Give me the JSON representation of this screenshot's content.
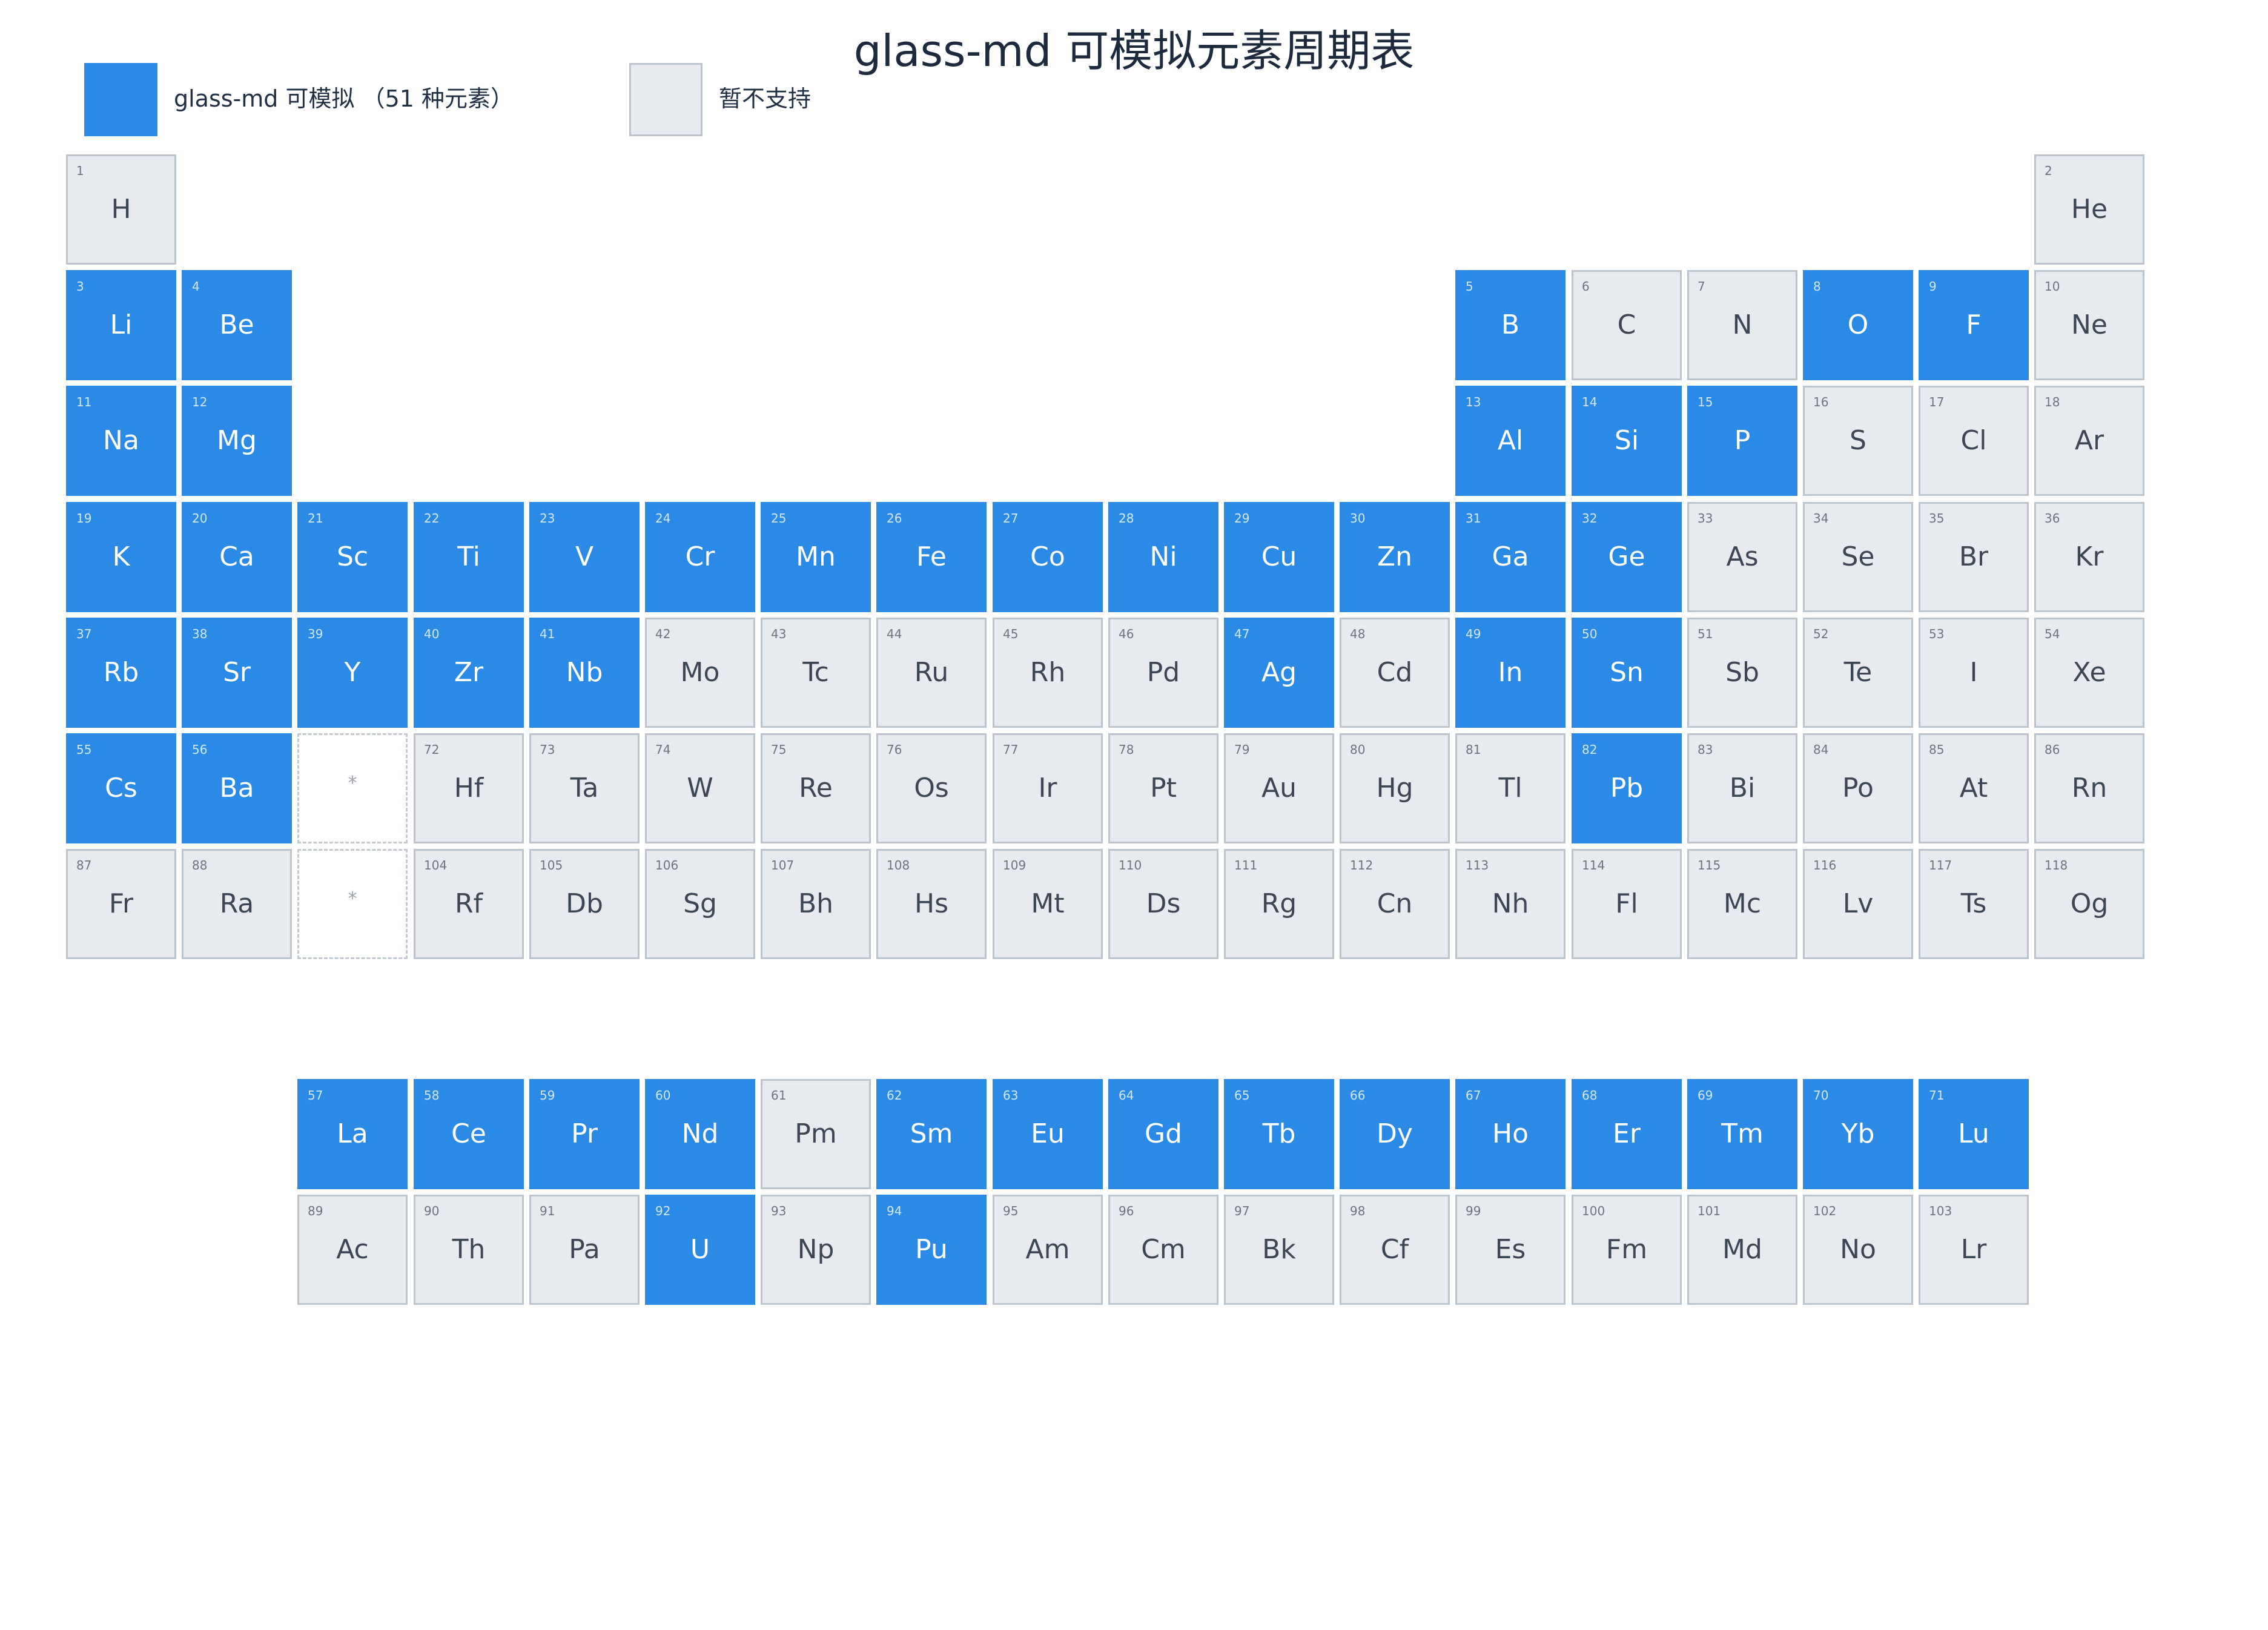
{
  "title": "glass-md 可模拟元素周期表",
  "legend": {
    "supported_label": "glass-md 可模拟 （51 种元素）",
    "unsupported_label": "暂不支持"
  },
  "colors": {
    "supported": "#2a8ae6",
    "unsupported": "#e7eaee",
    "unsupported_border": "#bcc4cd"
  },
  "placeholder_symbol": "*",
  "main_rows": [
    [
      [
        1,
        "H",
        0
      ],
      null,
      null,
      null,
      null,
      null,
      null,
      null,
      null,
      null,
      null,
      null,
      null,
      null,
      null,
      null,
      null,
      [
        2,
        "He",
        0
      ]
    ],
    [
      [
        3,
        "Li",
        1
      ],
      [
        4,
        "Be",
        1
      ],
      null,
      null,
      null,
      null,
      null,
      null,
      null,
      null,
      null,
      null,
      [
        5,
        "B",
        1
      ],
      [
        6,
        "C",
        0
      ],
      [
        7,
        "N",
        0
      ],
      [
        8,
        "O",
        1
      ],
      [
        9,
        "F",
        1
      ],
      [
        10,
        "Ne",
        0
      ]
    ],
    [
      [
        11,
        "Na",
        1
      ],
      [
        12,
        "Mg",
        1
      ],
      null,
      null,
      null,
      null,
      null,
      null,
      null,
      null,
      null,
      null,
      [
        13,
        "Al",
        1
      ],
      [
        14,
        "Si",
        1
      ],
      [
        15,
        "P",
        1
      ],
      [
        16,
        "S",
        0
      ],
      [
        17,
        "Cl",
        0
      ],
      [
        18,
        "Ar",
        0
      ]
    ],
    [
      [
        19,
        "K",
        1
      ],
      [
        20,
        "Ca",
        1
      ],
      [
        21,
        "Sc",
        1
      ],
      [
        22,
        "Ti",
        1
      ],
      [
        23,
        "V",
        1
      ],
      [
        24,
        "Cr",
        1
      ],
      [
        25,
        "Mn",
        1
      ],
      [
        26,
        "Fe",
        1
      ],
      [
        27,
        "Co",
        1
      ],
      [
        28,
        "Ni",
        1
      ],
      [
        29,
        "Cu",
        1
      ],
      [
        30,
        "Zn",
        1
      ],
      [
        31,
        "Ga",
        1
      ],
      [
        32,
        "Ge",
        1
      ],
      [
        33,
        "As",
        0
      ],
      [
        34,
        "Se",
        0
      ],
      [
        35,
        "Br",
        0
      ],
      [
        36,
        "Kr",
        0
      ]
    ],
    [
      [
        37,
        "Rb",
        1
      ],
      [
        38,
        "Sr",
        1
      ],
      [
        39,
        "Y",
        1
      ],
      [
        40,
        "Zr",
        1
      ],
      [
        41,
        "Nb",
        1
      ],
      [
        42,
        "Mo",
        0
      ],
      [
        43,
        "Tc",
        0
      ],
      [
        44,
        "Ru",
        0
      ],
      [
        45,
        "Rh",
        0
      ],
      [
        46,
        "Pd",
        0
      ],
      [
        47,
        "Ag",
        1
      ],
      [
        48,
        "Cd",
        0
      ],
      [
        49,
        "In",
        1
      ],
      [
        50,
        "Sn",
        1
      ],
      [
        51,
        "Sb",
        0
      ],
      [
        52,
        "Te",
        0
      ],
      [
        53,
        "I",
        0
      ],
      [
        54,
        "Xe",
        0
      ]
    ],
    [
      [
        55,
        "Cs",
        1
      ],
      [
        56,
        "Ba",
        1
      ],
      "*",
      [
        72,
        "Hf",
        0
      ],
      [
        73,
        "Ta",
        0
      ],
      [
        74,
        "W",
        0
      ],
      [
        75,
        "Re",
        0
      ],
      [
        76,
        "Os",
        0
      ],
      [
        77,
        "Ir",
        0
      ],
      [
        78,
        "Pt",
        0
      ],
      [
        79,
        "Au",
        0
      ],
      [
        80,
        "Hg",
        0
      ],
      [
        81,
        "Tl",
        0
      ],
      [
        82,
        "Pb",
        1
      ],
      [
        83,
        "Bi",
        0
      ],
      [
        84,
        "Po",
        0
      ],
      [
        85,
        "At",
        0
      ],
      [
        86,
        "Rn",
        0
      ]
    ],
    [
      [
        87,
        "Fr",
        0
      ],
      [
        88,
        "Ra",
        0
      ],
      "*",
      [
        104,
        "Rf",
        0
      ],
      [
        105,
        "Db",
        0
      ],
      [
        106,
        "Sg",
        0
      ],
      [
        107,
        "Bh",
        0
      ],
      [
        108,
        "Hs",
        0
      ],
      [
        109,
        "Mt",
        0
      ],
      [
        110,
        "Ds",
        0
      ],
      [
        111,
        "Rg",
        0
      ],
      [
        112,
        "Cn",
        0
      ],
      [
        113,
        "Nh",
        0
      ],
      [
        114,
        "Fl",
        0
      ],
      [
        115,
        "Mc",
        0
      ],
      [
        116,
        "Lv",
        0
      ],
      [
        117,
        "Ts",
        0
      ],
      [
        118,
        "Og",
        0
      ]
    ]
  ],
  "lanthanides": [
    [
      57,
      "La",
      1
    ],
    [
      58,
      "Ce",
      1
    ],
    [
      59,
      "Pr",
      1
    ],
    [
      60,
      "Nd",
      1
    ],
    [
      61,
      "Pm",
      0
    ],
    [
      62,
      "Sm",
      1
    ],
    [
      63,
      "Eu",
      1
    ],
    [
      64,
      "Gd",
      1
    ],
    [
      65,
      "Tb",
      1
    ],
    [
      66,
      "Dy",
      1
    ],
    [
      67,
      "Ho",
      1
    ],
    [
      68,
      "Er",
      1
    ],
    [
      69,
      "Tm",
      1
    ],
    [
      70,
      "Yb",
      1
    ],
    [
      71,
      "Lu",
      1
    ]
  ],
  "actinides": [
    [
      89,
      "Ac",
      0
    ],
    [
      90,
      "Th",
      0
    ],
    [
      91,
      "Pa",
      0
    ],
    [
      92,
      "U",
      1
    ],
    [
      93,
      "Np",
      0
    ],
    [
      94,
      "Pu",
      1
    ],
    [
      95,
      "Am",
      0
    ],
    [
      96,
      "Cm",
      0
    ],
    [
      97,
      "Bk",
      0
    ],
    [
      98,
      "Cf",
      0
    ],
    [
      99,
      "Es",
      0
    ],
    [
      100,
      "Fm",
      0
    ],
    [
      101,
      "Md",
      0
    ],
    [
      102,
      "No",
      0
    ],
    [
      103,
      "Lr",
      0
    ]
  ]
}
